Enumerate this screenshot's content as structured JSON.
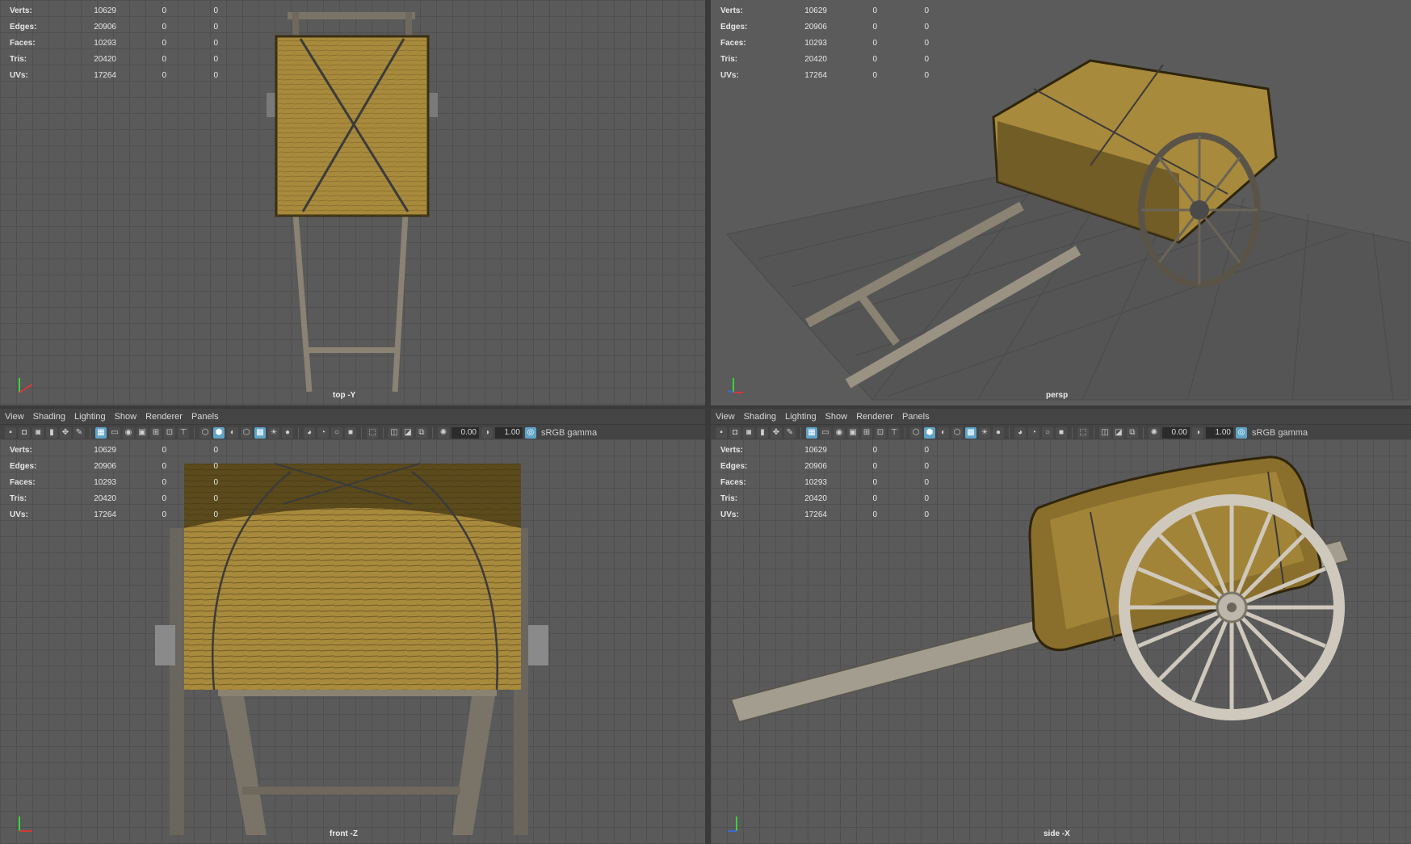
{
  "hud": {
    "rows": [
      {
        "label": "Verts:",
        "v1": "10629",
        "v2": "0",
        "v3": "0"
      },
      {
        "label": "Edges:",
        "v1": "20906",
        "v2": "0",
        "v3": "0"
      },
      {
        "label": "Faces:",
        "v1": "10293",
        "v2": "0",
        "v3": "0"
      },
      {
        "label": "Tris:",
        "v1": "20420",
        "v2": "0",
        "v3": "0"
      },
      {
        "label": "UVs:",
        "v1": "17264",
        "v2": "0",
        "v3": "0"
      }
    ]
  },
  "menu": {
    "view": "View",
    "shading": "Shading",
    "lighting": "Lighting",
    "show": "Show",
    "renderer": "Renderer",
    "panels": "Panels"
  },
  "toolbar": {
    "exposure": "0.00",
    "gamma_value": "1.00",
    "color_space": "sRGB gamma"
  },
  "cameras": {
    "top": "top -Y",
    "persp": "persp",
    "front": "front -Z",
    "side": "side -X"
  },
  "axis_labels": {
    "x": "x",
    "y": "y",
    "z": "z"
  },
  "colors": {
    "hay": "#a88a3c",
    "hay_dark": "#6b5620",
    "wood": "#8a8272",
    "wheel_light": "#cfc8bc",
    "axis_x": "#d23a3a",
    "axis_y": "#3ad23a",
    "axis_z": "#3a6ad2"
  }
}
